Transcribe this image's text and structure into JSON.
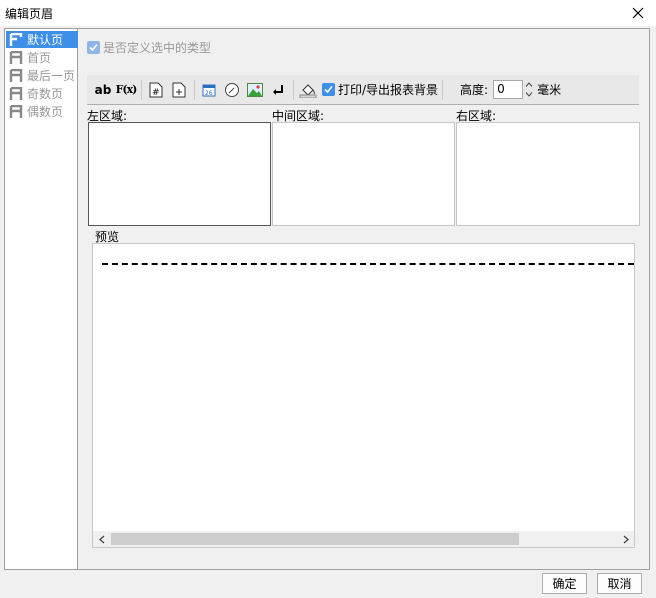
{
  "window": {
    "title": "编辑页眉"
  },
  "nav": {
    "items": [
      {
        "label": "默认页",
        "selected": true
      },
      {
        "label": "首页",
        "selected": false
      },
      {
        "label": "最后一页",
        "selected": false
      },
      {
        "label": "奇数页",
        "selected": false
      },
      {
        "label": "偶数页",
        "selected": false
      }
    ]
  },
  "custom_type": {
    "label": "是否定义选中的类型",
    "checked": true,
    "enabled": false
  },
  "toolbar": {
    "text_icon_label": "ab",
    "formula_icon_label": "F(x)",
    "print_bg": {
      "label": "打印/导出报表背景",
      "checked": true
    },
    "height_label": "高度:",
    "height_value": "0",
    "height_unit": "毫米"
  },
  "zones": {
    "left_label": "左区域:",
    "center_label": "中间区域:",
    "right_label": "右区域:"
  },
  "preview": {
    "label": "预览"
  },
  "buttons": {
    "ok": "确定",
    "cancel": "取消"
  },
  "colors": {
    "accent": "#3d8fe8"
  }
}
